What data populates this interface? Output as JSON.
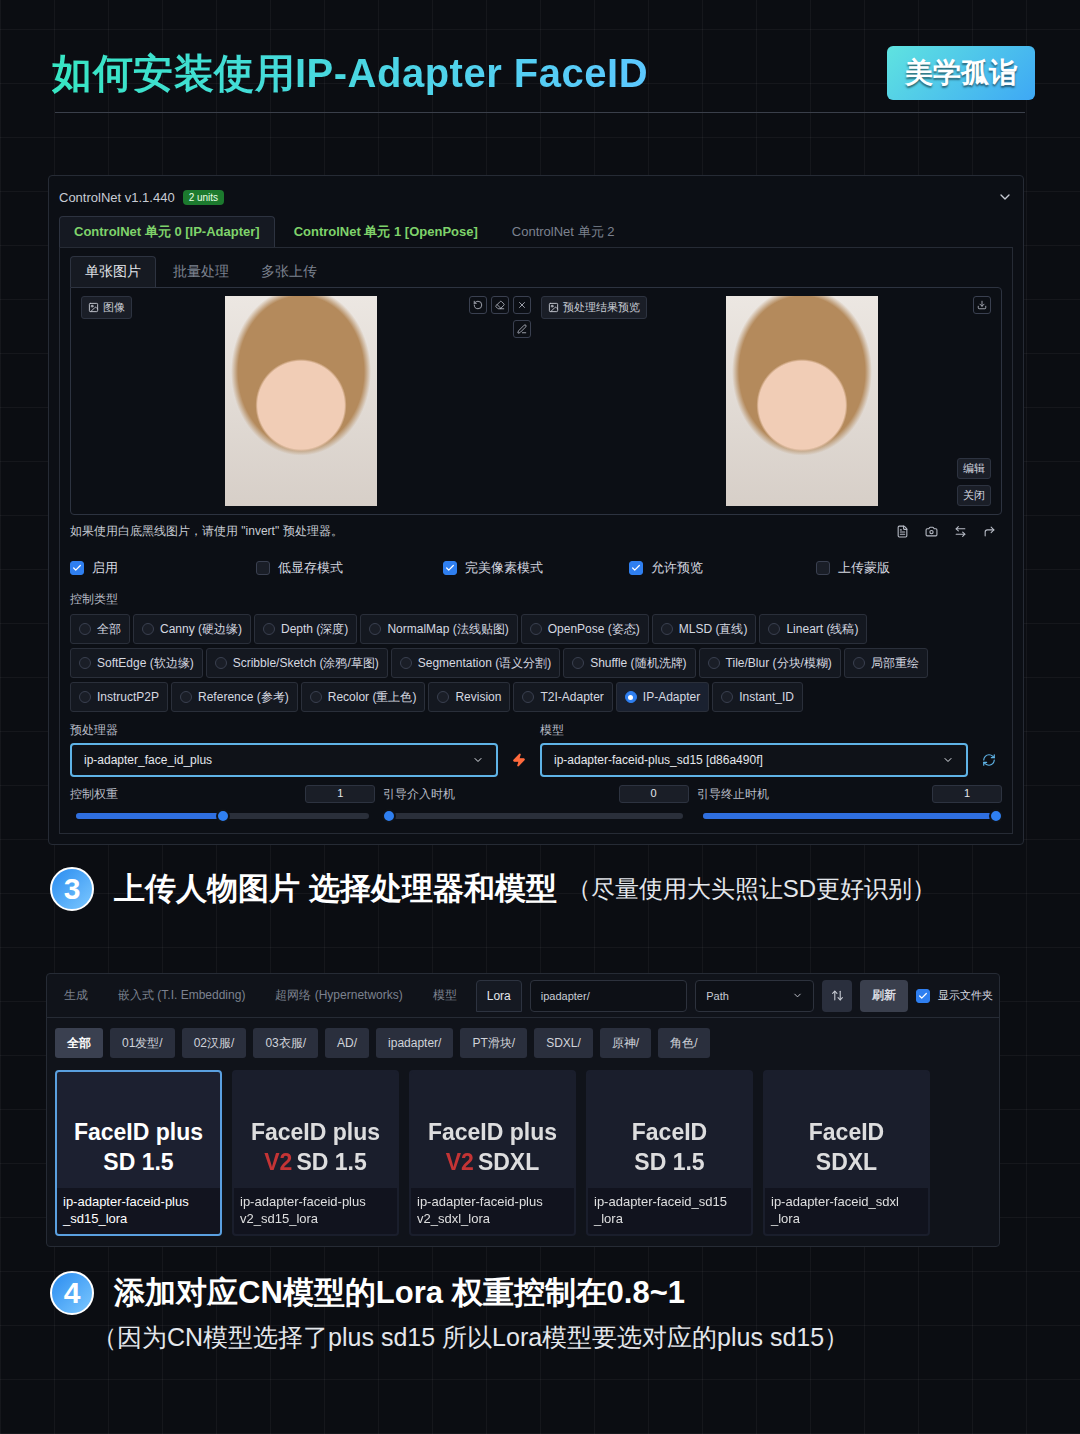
{
  "page": {
    "title": "如何安装使用IP-Adapter FaceID",
    "badge": "美学孤诣"
  },
  "controlnet": {
    "title": "ControlNet v1.1.440",
    "units_badge": "2 units",
    "tabs": [
      {
        "label": "ControlNet 单元 0 [IP-Adapter]",
        "selected": true,
        "enabled": true
      },
      {
        "label": "ControlNet 单元 1 [OpenPose]",
        "selected": false,
        "enabled": true
      },
      {
        "label": "ControlNet 单元 2",
        "selected": false,
        "enabled": false
      }
    ],
    "subtabs": [
      {
        "label": "单张图片",
        "selected": true
      },
      {
        "label": "批量处理",
        "selected": false
      },
      {
        "label": "多张上传",
        "selected": false
      }
    ],
    "image_label": "图像",
    "preview_label": "预处理结果预览",
    "edit_buttons": [
      "编辑",
      "关闭"
    ],
    "hint": "如果使用白底黑线图片，请使用 \"invert\" 预处理器。",
    "options": [
      {
        "label": "启用",
        "checked": true
      },
      {
        "label": "低显存模式",
        "checked": false
      },
      {
        "label": "完美像素模式",
        "checked": true
      },
      {
        "label": "允许预览",
        "checked": true
      },
      {
        "label": "上传蒙版",
        "checked": false
      }
    ],
    "control_type_label": "控制类型",
    "control_types": [
      [
        {
          "label": "全部",
          "selected": false
        },
        {
          "label": "Canny (硬边缘)",
          "selected": false
        },
        {
          "label": "Depth (深度)",
          "selected": false
        },
        {
          "label": "NormalMap (法线贴图)",
          "selected": false
        },
        {
          "label": "OpenPose (姿态)",
          "selected": false
        },
        {
          "label": "MLSD (直线)",
          "selected": false
        },
        {
          "label": "Lineart (线稿)",
          "selected": false
        }
      ],
      [
        {
          "label": "SoftEdge (软边缘)",
          "selected": false
        },
        {
          "label": "Scribble/Sketch (涂鸦/草图)",
          "selected": false
        },
        {
          "label": "Segmentation (语义分割)",
          "selected": false
        },
        {
          "label": "Shuffle (随机洗牌)",
          "selected": false
        },
        {
          "label": "Tile/Blur (分块/模糊)",
          "selected": false
        },
        {
          "label": "局部重绘",
          "selected": false
        }
      ],
      [
        {
          "label": "InstructP2P",
          "selected": false
        },
        {
          "label": "Reference (参考)",
          "selected": false
        },
        {
          "label": "Recolor (重上色)",
          "selected": false
        },
        {
          "label": "Revision",
          "selected": false
        },
        {
          "label": "T2I-Adapter",
          "selected": false
        },
        {
          "label": "IP-Adapter",
          "selected": true
        },
        {
          "label": "Instant_ID",
          "selected": false
        }
      ]
    ],
    "preprocessor": {
      "label": "预处理器",
      "value": "ip-adapter_face_id_plus"
    },
    "model": {
      "label": "模型",
      "value": "ip-adapter-faceid-plus_sd15 [d86a490f]"
    },
    "sliders": [
      {
        "label": "控制权重",
        "value": "1",
        "level": 0.5
      },
      {
        "label": "引导介入时机",
        "value": "0",
        "level": 0
      },
      {
        "label": "引导终止时机",
        "value": "1",
        "level": 1
      }
    ]
  },
  "step3": {
    "number": "3",
    "title": "上传人物图片 选择处理器和模型",
    "note": "（尽量使用大头照让SD更好识别）"
  },
  "lora_panel": {
    "tabs": [
      {
        "label": "生成",
        "selected": false
      },
      {
        "label": "嵌入式 (T.I. Embedding)",
        "selected": false
      },
      {
        "label": "超网络 (Hypernetworks)",
        "selected": false
      },
      {
        "label": "模型",
        "selected": false
      },
      {
        "label": "Lora",
        "selected": true
      }
    ],
    "search": {
      "value": "ipadapter/"
    },
    "sort_select": {
      "value": "Path"
    },
    "refresh_button": "刷新",
    "show_folders": {
      "label": "显示文件夹",
      "checked": true
    },
    "folders": [
      {
        "label": "全部",
        "selected": true
      },
      {
        "label": "01发型/",
        "selected": false
      },
      {
        "label": "02汉服/",
        "selected": false
      },
      {
        "label": "03衣服/",
        "selected": false
      },
      {
        "label": "AD/",
        "selected": false
      },
      {
        "label": "ipadapter/",
        "selected": false
      },
      {
        "label": "PT滑块/",
        "selected": false
      },
      {
        "label": "SDXL/",
        "selected": false
      },
      {
        "label": "原神/",
        "selected": false
      },
      {
        "label": "角色/",
        "selected": false
      }
    ],
    "cards": [
      {
        "title": "FaceID plus",
        "subtitle": "SD 1.5",
        "file_lines": [
          "ip-adapter-faceid-plus",
          "_sd15_lora"
        ],
        "selected": true
      },
      {
        "title": "FaceID plus",
        "tag": "V2",
        "subtitle": "SD 1.5",
        "file_lines": [
          "ip-adapter-faceid-plus",
          "v2_sd15_lora"
        ],
        "selected": false
      },
      {
        "title": "FaceID plus",
        "tag": "V2",
        "subtitle": "SDXL",
        "file_lines": [
          "ip-adapter-faceid-plus",
          "v2_sdxl_lora"
        ],
        "selected": false
      },
      {
        "title": "FaceID",
        "subtitle": "SD 1.5",
        "file_lines": [
          "ip-adapter-faceid_sd15",
          "_lora"
        ],
        "selected": false
      },
      {
        "title": "FaceID",
        "subtitle": "SDXL",
        "file_lines": [
          "ip-adapter-faceid_sdxl",
          "_lora"
        ],
        "selected": false
      }
    ]
  },
  "step4": {
    "number": "4",
    "title": "添加对应CN模型的Lora  权重控制在0.8~1",
    "note": "（因为CN模型选择了plus sd15  所以Lora模型要选对应的plus sd15）"
  }
}
